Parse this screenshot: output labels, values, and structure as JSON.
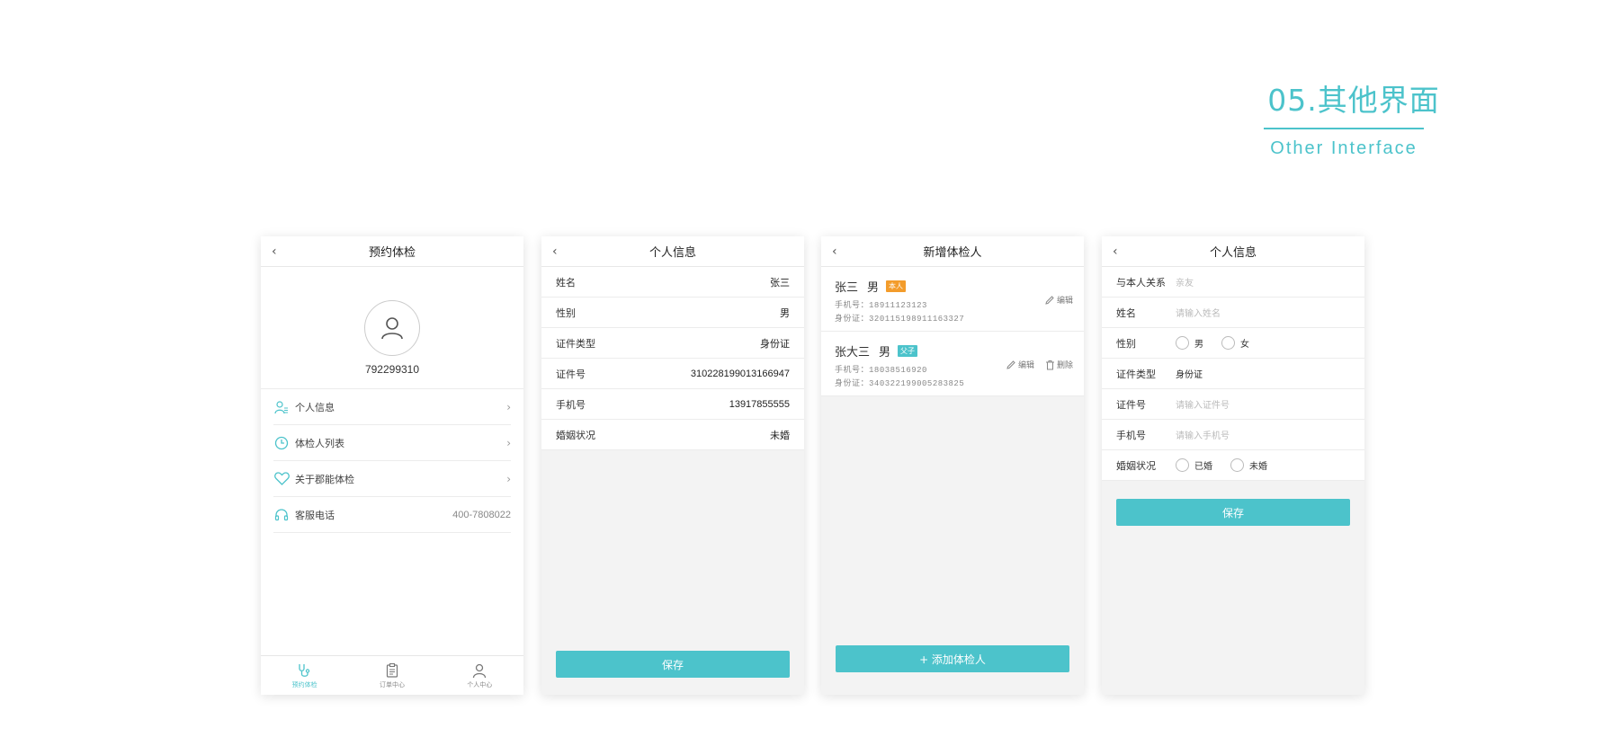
{
  "section": {
    "title_cn": "05.其他界面",
    "title_en": "Other Interface"
  },
  "colors": {
    "accent": "#4cc3cb",
    "tag_self": "#f39c2b"
  },
  "screen1": {
    "title": "预约体检",
    "user_id": "792299310",
    "menu": [
      {
        "label": "个人信息",
        "icon": "user-list-icon"
      },
      {
        "label": "体检人列表",
        "icon": "clock-icon"
      },
      {
        "label": "关于郡能体检",
        "icon": "heart-icon"
      },
      {
        "label": "客服电话",
        "icon": "headset-icon",
        "value": "400-7808022"
      }
    ],
    "tabs": [
      {
        "label": "预约体检",
        "icon": "stethoscope-icon",
        "active": true
      },
      {
        "label": "订单中心",
        "icon": "clipboard-icon"
      },
      {
        "label": "个人中心",
        "icon": "person-icon"
      }
    ]
  },
  "screen2": {
    "title": "个人信息",
    "rows": [
      {
        "label": "姓名",
        "value": "张三"
      },
      {
        "label": "性别",
        "value": "男"
      },
      {
        "label": "证件类型",
        "value": "身份证"
      },
      {
        "label": "证件号",
        "value": "310228199013166947"
      },
      {
        "label": "手机号",
        "value": "13917855555"
      },
      {
        "label": "婚姻状况",
        "value": "未婚"
      }
    ],
    "save_label": "保存"
  },
  "screen3": {
    "title": "新增体检人",
    "people": [
      {
        "name": "张三",
        "gender": "男",
        "tag": "本人",
        "phone_label": "手机号：",
        "phone": "18911123123",
        "id_label": "身份证：",
        "id": "320115198911163327",
        "edit": "编辑"
      },
      {
        "name": "张大三",
        "gender": "男",
        "tag": "父子",
        "phone_label": "手机号：",
        "phone": "18038516920",
        "id_label": "身份证：",
        "id": "340322199005283825",
        "edit": "编辑",
        "delete": "删除"
      }
    ],
    "add_label": "+ 添加体检人"
  },
  "screen4": {
    "title": "个人信息",
    "rows": [
      {
        "label": "与本人关系",
        "placeholder": "亲友"
      },
      {
        "label": "姓名",
        "placeholder": "请输入姓名"
      },
      {
        "label": "性别",
        "options": [
          "男",
          "女"
        ]
      },
      {
        "label": "证件类型",
        "value": "身份证"
      },
      {
        "label": "证件号",
        "placeholder": "请输入证件号"
      },
      {
        "label": "手机号",
        "placeholder": "请输入手机号"
      },
      {
        "label": "婚姻状况",
        "options": [
          "已婚",
          "未婚"
        ]
      }
    ],
    "save_label": "保存"
  }
}
